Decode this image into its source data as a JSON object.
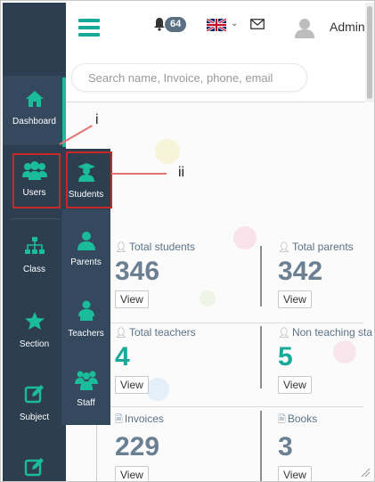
{
  "header": {
    "notification_count": "64",
    "user_name": "Admin",
    "search_placeholder": "Search name, Invoice, phone, email"
  },
  "sidebar": {
    "items": [
      {
        "label": "Dashboard",
        "icon": "home-icon"
      },
      {
        "label": "Users",
        "icon": "users-icon"
      },
      {
        "label": "Class",
        "icon": "sitemap-icon"
      },
      {
        "label": "Section",
        "icon": "star-icon"
      },
      {
        "label": "Subject",
        "icon": "edit-icon"
      }
    ]
  },
  "submenu": {
    "items": [
      {
        "label": "Students",
        "icon": "graduate-icon"
      },
      {
        "label": "Parents",
        "icon": "user-icon"
      },
      {
        "label": "Teachers",
        "icon": "teacher-icon"
      },
      {
        "label": "Staff",
        "icon": "group-icon"
      }
    ]
  },
  "stats": [
    {
      "title": "Total students",
      "value": "346",
      "button": "View"
    },
    {
      "title": "Total parents",
      "value": "342",
      "button": "View"
    },
    {
      "title": "Total teachers",
      "value": "4",
      "button": "View"
    },
    {
      "title": "Non teaching sta",
      "value": "5",
      "button": "View"
    },
    {
      "title": "Invoices",
      "value": "229",
      "button": "View"
    },
    {
      "title": "Books",
      "value": "3",
      "button": "View"
    }
  ],
  "annotations": {
    "label_i": "i",
    "label_ii": "ii"
  },
  "colors": {
    "sidebar": "#2c3e50",
    "submenu": "#34495e",
    "accent": "#1abc9c",
    "highlight": "#c62828"
  }
}
